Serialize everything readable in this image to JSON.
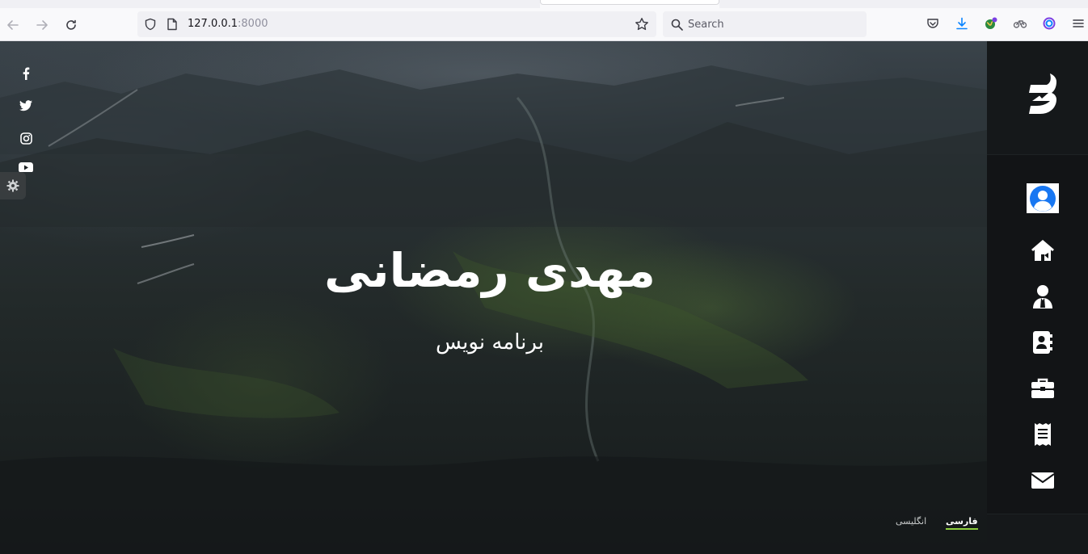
{
  "browser": {
    "url_host": "127.0.0.1",
    "url_port": ":8000",
    "search_placeholder": "Search"
  },
  "hero": {
    "name": "مهدی رمضانی",
    "role": "برنامه نویس"
  },
  "social_links": [
    {
      "icon": "facebook-icon"
    },
    {
      "icon": "twitter-icon"
    },
    {
      "icon": "instagram-icon"
    },
    {
      "icon": "youtube-icon"
    }
  ],
  "languages": {
    "active": "فارسی",
    "inactive": "انگلیسی"
  },
  "sidebar": {
    "items": [
      {
        "icon": "home-icon"
      },
      {
        "icon": "user-icon"
      },
      {
        "icon": "contact-book-icon"
      },
      {
        "icon": "briefcase-icon"
      },
      {
        "icon": "receipt-icon"
      },
      {
        "icon": "envelope-icon"
      }
    ]
  },
  "colors": {
    "accent": "#8ecf3e",
    "sidebar_bg": "#121416",
    "avatar_blue": "#1877f2"
  }
}
